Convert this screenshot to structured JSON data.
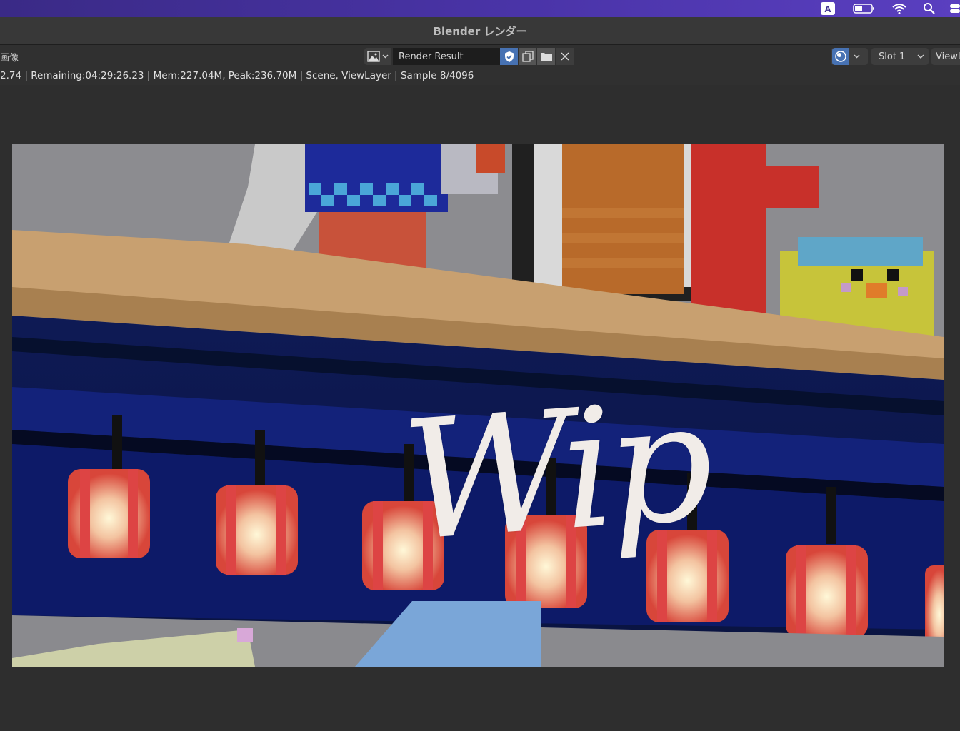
{
  "window": {
    "title": "Blender レンダー"
  },
  "menubar": {
    "input_source": "A",
    "icons": [
      "battery-icon",
      "wifi-icon",
      "spotlight-search-icon",
      "control-center-icon"
    ]
  },
  "header": {
    "editor_label": "画像",
    "image_name": "Render Result",
    "slot": "Slot 1",
    "view_layer": "ViewLayer"
  },
  "status": {
    "text": "2.74 | Remaining:04:29:26.23 | Mem:227.04M, Peak:236.70M | Scene, ViewLayer | Sample 8/4096"
  },
  "render": {
    "overlay_text": "Wip"
  },
  "colors": {
    "accent": "#4772b3",
    "menubar": "#4a34a8",
    "editor_bg": "#2b2b2b"
  }
}
